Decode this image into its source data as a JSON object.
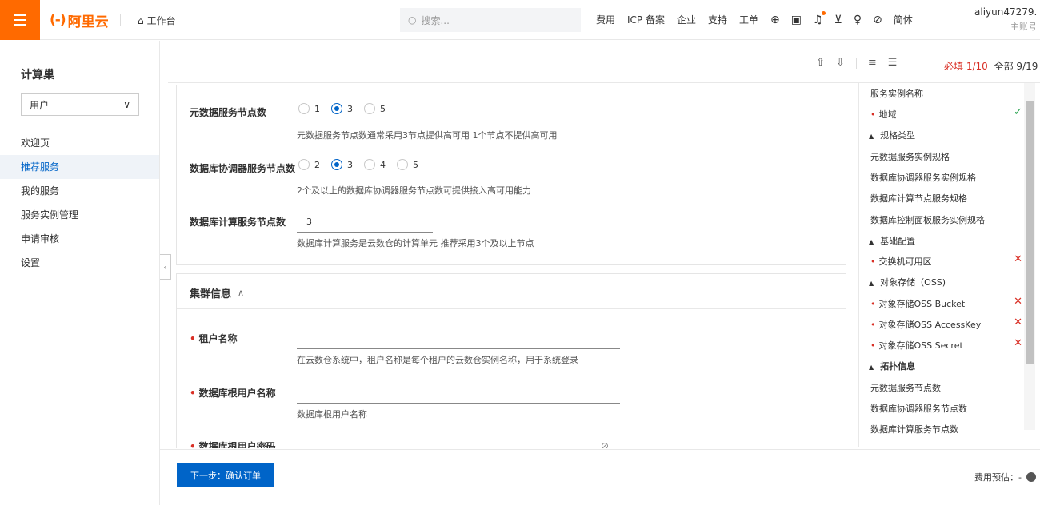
{
  "topbar": {
    "logo_text": "阿里云",
    "logo_mark": "(-)",
    "workbench": "工作台",
    "search_placeholder": "搜索...",
    "nav": [
      "费用",
      "ICP 备案",
      "企业",
      "支持",
      "工单"
    ],
    "lang": "简体",
    "user_name": "aliyun47279...",
    "user_role": "主账号"
  },
  "sidebar": {
    "title": "计算巢",
    "select_value": "用户",
    "items": [
      {
        "label": "欢迎页",
        "active": false
      },
      {
        "label": "推荐服务",
        "active": true
      },
      {
        "label": "我的服务",
        "active": false
      },
      {
        "label": "服务实例管理",
        "active": false
      },
      {
        "label": "申请审核",
        "active": false
      },
      {
        "label": "设置",
        "active": false
      }
    ]
  },
  "toolbar": {
    "required": "必填 1/10",
    "all": "全部 9/19"
  },
  "form": {
    "meta_nodes": {
      "label": "元数据服务节点数",
      "options": [
        "1",
        "3",
        "5"
      ],
      "selected": "3",
      "help": "元数据服务节点数通常采用3节点提供高可用 1个节点不提供高可用"
    },
    "coordinator_nodes": {
      "label": "数据库协调器服务节点数",
      "options": [
        "2",
        "3",
        "4",
        "5"
      ],
      "selected": "3",
      "help": "2个及以上的数据库协调器服务节点数可提供接入高可用能力"
    },
    "compute_nodes": {
      "label": "数据库计算服务节点数",
      "value": "3",
      "help": "数据库计算服务是云数仓的计算单元 推荐采用3个及以上节点"
    },
    "cluster_section": {
      "title": "集群信息",
      "tenant_label": "租户名称",
      "tenant_help": "在云数仓系统中，租户名称是每个租户的云数仓实例名称，用于系统登录",
      "root_user_label": "数据库根用户名称",
      "root_user_help": "数据库根用户名称",
      "root_pwd_label": "数据库根用户密码"
    }
  },
  "right_panel": {
    "items": [
      {
        "label": "服务实例名称",
        "type": "item",
        "required": false,
        "status": ""
      },
      {
        "label": "地域",
        "type": "item",
        "required": true,
        "status": "ok"
      },
      {
        "label": "规格类型",
        "type": "group",
        "required": false,
        "status": ""
      },
      {
        "label": "元数据服务实例规格",
        "type": "item",
        "required": false,
        "status": ""
      },
      {
        "label": "数据库协调器服务实例规格",
        "type": "item",
        "required": false,
        "status": ""
      },
      {
        "label": "数据库计算节点服务规格",
        "type": "item",
        "required": false,
        "status": ""
      },
      {
        "label": "数据库控制面板服务实例规格",
        "type": "item",
        "required": false,
        "status": ""
      },
      {
        "label": "基础配置",
        "type": "group",
        "required": false,
        "status": ""
      },
      {
        "label": "交换机可用区",
        "type": "item",
        "required": true,
        "status": "bad"
      },
      {
        "label": "对象存储（OSS)",
        "type": "group",
        "required": false,
        "status": ""
      },
      {
        "label": "对象存储OSS Bucket",
        "type": "item",
        "required": true,
        "status": "bad"
      },
      {
        "label": "对象存储OSS AccessKey",
        "type": "item",
        "required": true,
        "status": "bad"
      },
      {
        "label": "对象存储OSS Secret",
        "type": "item",
        "required": true,
        "status": "bad"
      },
      {
        "label": "拓扑信息",
        "type": "group-bold",
        "required": false,
        "status": ""
      },
      {
        "label": "元数据服务节点数",
        "type": "item",
        "required": false,
        "status": ""
      },
      {
        "label": "数据库协调器服务节点数",
        "type": "item",
        "required": false,
        "status": ""
      },
      {
        "label": "数据库计算服务节点数",
        "type": "item",
        "required": false,
        "status": ""
      }
    ]
  },
  "footer": {
    "next_button": "下一步：确认订单",
    "fee_label": "费用预估：-"
  },
  "colors": {
    "brand": "#ff6a00",
    "primary": "#0064c8",
    "error": "#d93026",
    "success": "#1e9e47"
  }
}
